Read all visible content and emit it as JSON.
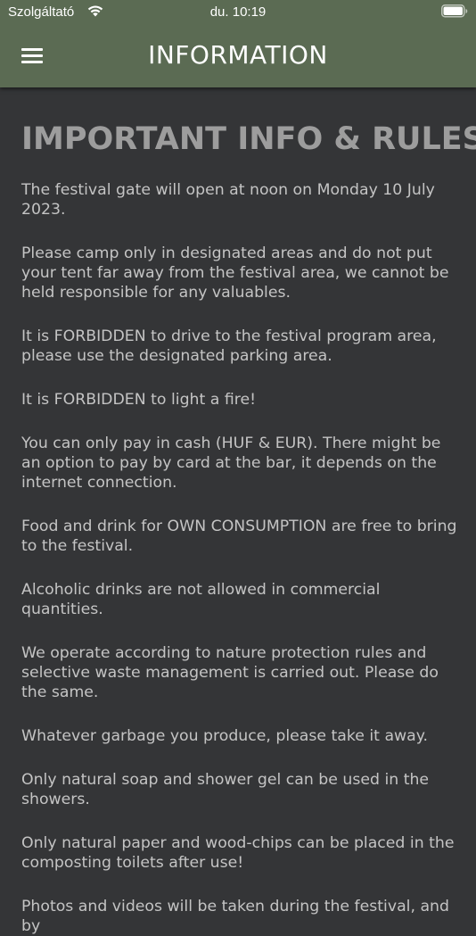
{
  "status_bar": {
    "carrier": "Szolgáltató",
    "time": "du. 10:19"
  },
  "header": {
    "title": "INFORMATION",
    "menu_icon": "hamburger-menu-icon"
  },
  "content": {
    "heading": "IMPORTANT INFO & RULES",
    "paragraphs": [
      "The festival gate will open at noon on Monday 10 July 2023.",
      "Please camp only in designated areas and do not put your tent far away from the festival area, we cannot be held responsible for any valuables.",
      "It is FORBIDDEN to drive to the festival program area, please use the designated parking area.",
      "It is FORBIDDEN to light a fire!",
      "You can only pay in cash (HUF & EUR). There might be an option to pay by card at the bar, it depends on the internet connection.",
      "Food and drink for OWN CONSUMPTION are free to bring to the festival.",
      "Alcoholic drinks are not allowed in commercial quantities.",
      "We operate according to nature protection rules and selective waste management is carried out. Please do the same.",
      "Whatever garbage you produce, please take it away.",
      "Only natural soap and shower gel can be used in the showers.",
      "Only natural paper and wood-chips can be placed in the composting toilets after use!",
      "Photos and videos will be taken during the festival, and by"
    ]
  },
  "colors": {
    "header_bg": "#5b6b53",
    "page_bg": "#343537",
    "heading_text": "#9d9d9d",
    "body_text": "#c4c4c4"
  }
}
